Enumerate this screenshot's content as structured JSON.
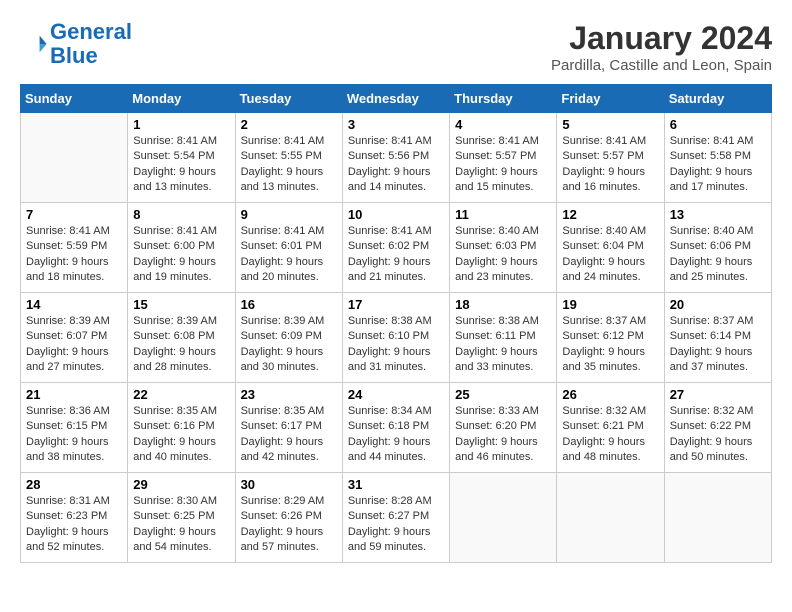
{
  "header": {
    "logo_line1": "General",
    "logo_line2": "Blue",
    "month": "January 2024",
    "location": "Pardilla, Castille and Leon, Spain"
  },
  "days_of_week": [
    "Sunday",
    "Monday",
    "Tuesday",
    "Wednesday",
    "Thursday",
    "Friday",
    "Saturday"
  ],
  "weeks": [
    [
      {
        "day": "",
        "info": ""
      },
      {
        "day": "1",
        "info": "Sunrise: 8:41 AM\nSunset: 5:54 PM\nDaylight: 9 hours\nand 13 minutes."
      },
      {
        "day": "2",
        "info": "Sunrise: 8:41 AM\nSunset: 5:55 PM\nDaylight: 9 hours\nand 13 minutes."
      },
      {
        "day": "3",
        "info": "Sunrise: 8:41 AM\nSunset: 5:56 PM\nDaylight: 9 hours\nand 14 minutes."
      },
      {
        "day": "4",
        "info": "Sunrise: 8:41 AM\nSunset: 5:57 PM\nDaylight: 9 hours\nand 15 minutes."
      },
      {
        "day": "5",
        "info": "Sunrise: 8:41 AM\nSunset: 5:57 PM\nDaylight: 9 hours\nand 16 minutes."
      },
      {
        "day": "6",
        "info": "Sunrise: 8:41 AM\nSunset: 5:58 PM\nDaylight: 9 hours\nand 17 minutes."
      }
    ],
    [
      {
        "day": "7",
        "info": "Sunrise: 8:41 AM\nSunset: 5:59 PM\nDaylight: 9 hours\nand 18 minutes."
      },
      {
        "day": "8",
        "info": "Sunrise: 8:41 AM\nSunset: 6:00 PM\nDaylight: 9 hours\nand 19 minutes."
      },
      {
        "day": "9",
        "info": "Sunrise: 8:41 AM\nSunset: 6:01 PM\nDaylight: 9 hours\nand 20 minutes."
      },
      {
        "day": "10",
        "info": "Sunrise: 8:41 AM\nSunset: 6:02 PM\nDaylight: 9 hours\nand 21 minutes."
      },
      {
        "day": "11",
        "info": "Sunrise: 8:40 AM\nSunset: 6:03 PM\nDaylight: 9 hours\nand 23 minutes."
      },
      {
        "day": "12",
        "info": "Sunrise: 8:40 AM\nSunset: 6:04 PM\nDaylight: 9 hours\nand 24 minutes."
      },
      {
        "day": "13",
        "info": "Sunrise: 8:40 AM\nSunset: 6:06 PM\nDaylight: 9 hours\nand 25 minutes."
      }
    ],
    [
      {
        "day": "14",
        "info": "Sunrise: 8:39 AM\nSunset: 6:07 PM\nDaylight: 9 hours\nand 27 minutes."
      },
      {
        "day": "15",
        "info": "Sunrise: 8:39 AM\nSunset: 6:08 PM\nDaylight: 9 hours\nand 28 minutes."
      },
      {
        "day": "16",
        "info": "Sunrise: 8:39 AM\nSunset: 6:09 PM\nDaylight: 9 hours\nand 30 minutes."
      },
      {
        "day": "17",
        "info": "Sunrise: 8:38 AM\nSunset: 6:10 PM\nDaylight: 9 hours\nand 31 minutes."
      },
      {
        "day": "18",
        "info": "Sunrise: 8:38 AM\nSunset: 6:11 PM\nDaylight: 9 hours\nand 33 minutes."
      },
      {
        "day": "19",
        "info": "Sunrise: 8:37 AM\nSunset: 6:12 PM\nDaylight: 9 hours\nand 35 minutes."
      },
      {
        "day": "20",
        "info": "Sunrise: 8:37 AM\nSunset: 6:14 PM\nDaylight: 9 hours\nand 37 minutes."
      }
    ],
    [
      {
        "day": "21",
        "info": "Sunrise: 8:36 AM\nSunset: 6:15 PM\nDaylight: 9 hours\nand 38 minutes."
      },
      {
        "day": "22",
        "info": "Sunrise: 8:35 AM\nSunset: 6:16 PM\nDaylight: 9 hours\nand 40 minutes."
      },
      {
        "day": "23",
        "info": "Sunrise: 8:35 AM\nSunset: 6:17 PM\nDaylight: 9 hours\nand 42 minutes."
      },
      {
        "day": "24",
        "info": "Sunrise: 8:34 AM\nSunset: 6:18 PM\nDaylight: 9 hours\nand 44 minutes."
      },
      {
        "day": "25",
        "info": "Sunrise: 8:33 AM\nSunset: 6:20 PM\nDaylight: 9 hours\nand 46 minutes."
      },
      {
        "day": "26",
        "info": "Sunrise: 8:32 AM\nSunset: 6:21 PM\nDaylight: 9 hours\nand 48 minutes."
      },
      {
        "day": "27",
        "info": "Sunrise: 8:32 AM\nSunset: 6:22 PM\nDaylight: 9 hours\nand 50 minutes."
      }
    ],
    [
      {
        "day": "28",
        "info": "Sunrise: 8:31 AM\nSunset: 6:23 PM\nDaylight: 9 hours\nand 52 minutes."
      },
      {
        "day": "29",
        "info": "Sunrise: 8:30 AM\nSunset: 6:25 PM\nDaylight: 9 hours\nand 54 minutes."
      },
      {
        "day": "30",
        "info": "Sunrise: 8:29 AM\nSunset: 6:26 PM\nDaylight: 9 hours\nand 57 minutes."
      },
      {
        "day": "31",
        "info": "Sunrise: 8:28 AM\nSunset: 6:27 PM\nDaylight: 9 hours\nand 59 minutes."
      },
      {
        "day": "",
        "info": ""
      },
      {
        "day": "",
        "info": ""
      },
      {
        "day": "",
        "info": ""
      }
    ]
  ]
}
